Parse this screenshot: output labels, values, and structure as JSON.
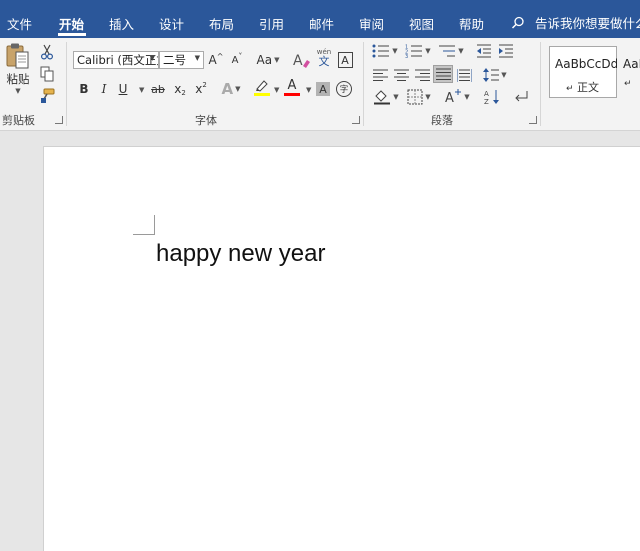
{
  "ribbon_tabs": [
    {
      "label": "文件",
      "active": false
    },
    {
      "label": "开始",
      "active": true
    },
    {
      "label": "插入",
      "active": false
    },
    {
      "label": "设计",
      "active": false
    },
    {
      "label": "布局",
      "active": false
    },
    {
      "label": "引用",
      "active": false
    },
    {
      "label": "邮件",
      "active": false
    },
    {
      "label": "审阅",
      "active": false
    },
    {
      "label": "视图",
      "active": false
    },
    {
      "label": "帮助",
      "active": false
    }
  ],
  "tell_me": {
    "text": "告诉我你想要做什么"
  },
  "clipboard": {
    "paste_label": "粘贴",
    "group_label": "剪贴板"
  },
  "font": {
    "font_name": "Calibri (西文正文)",
    "font_size": "二号",
    "grow_label": "A",
    "shrink_label": "A",
    "change_case_label": "Aa",
    "phonetic_label": "wén",
    "phonetic_char": "文",
    "border_char": "A",
    "bold": "B",
    "italic": "I",
    "underline": "U",
    "strike": "ab",
    "subscript": "x",
    "superscript": "x",
    "sub_mark": "2",
    "sup_mark": "2",
    "effects": "A",
    "highlight_letter": "ab",
    "font_color_letter": "A",
    "shading_letter": "A",
    "enclose_char": "字",
    "group_label": "字体"
  },
  "paragraph": {
    "group_label": "段落"
  },
  "styles": {
    "items": [
      {
        "sample": "AaBbCcDd",
        "name": "正文"
      },
      {
        "sample": "AaB",
        "name": ""
      }
    ]
  },
  "document": {
    "text": "happy new year"
  },
  "colors": {
    "ribbon_blue": "#2b579a",
    "highlight_yellow": "#ffff00",
    "font_red": "#ff0000"
  }
}
